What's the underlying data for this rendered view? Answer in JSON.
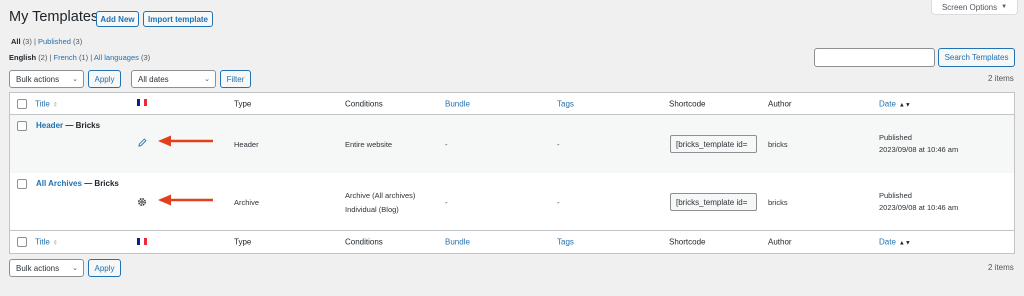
{
  "header": {
    "title": "My Templates",
    "add_new": "Add New",
    "import": "Import template",
    "screen_options": "Screen Options",
    "screen_options_arrow": "▼"
  },
  "views": {
    "all": "All",
    "all_count": "(3)",
    "sep": "|",
    "published": "Published",
    "published_count": "(3)"
  },
  "languages": {
    "english": "English",
    "english_count": "(2)",
    "sep": "|",
    "french": "French",
    "french_count": "(1)",
    "all": "All languages",
    "all_count": "(3)"
  },
  "search": {
    "value": "",
    "button": "Search Templates"
  },
  "tablenav_top": {
    "bulk_actions": "Bulk actions",
    "apply": "Apply",
    "dates": "All dates",
    "filter": "Filter",
    "items": "2 items"
  },
  "tablenav_bottom": {
    "bulk_actions": "Bulk actions",
    "apply": "Apply",
    "items": "2 items"
  },
  "columns": {
    "title": "Title",
    "type": "Type",
    "conditions": "Conditions",
    "bundle": "Bundle",
    "tags": "Tags",
    "shortcode": "Shortcode",
    "author": "Author",
    "date": "Date"
  },
  "flag_colors": [
    "#002395",
    "#ffffff",
    "#ed2939"
  ],
  "arrow_color": "#e2401c",
  "rows": [
    {
      "title": "Header",
      "suffix": "— Bricks",
      "icon": "pencil-icon",
      "type": "Header",
      "conditions": [
        "Entire website"
      ],
      "bundle": "-",
      "tags": "-",
      "shortcode": "[bricks_template id=",
      "author": "bricks",
      "status": "Published",
      "date": "2023/09/08 at 10:46 am"
    },
    {
      "title": "All Archives",
      "suffix": "— Bricks",
      "icon": "gear-icon",
      "type": "Archive",
      "conditions": [
        "Archive (All archives)",
        "Individual (Blog)"
      ],
      "bundle": "-",
      "tags": "-",
      "shortcode": "[bricks_template id=",
      "author": "bricks",
      "status": "Published",
      "date": "2023/09/08 at 10:46 am"
    }
  ]
}
